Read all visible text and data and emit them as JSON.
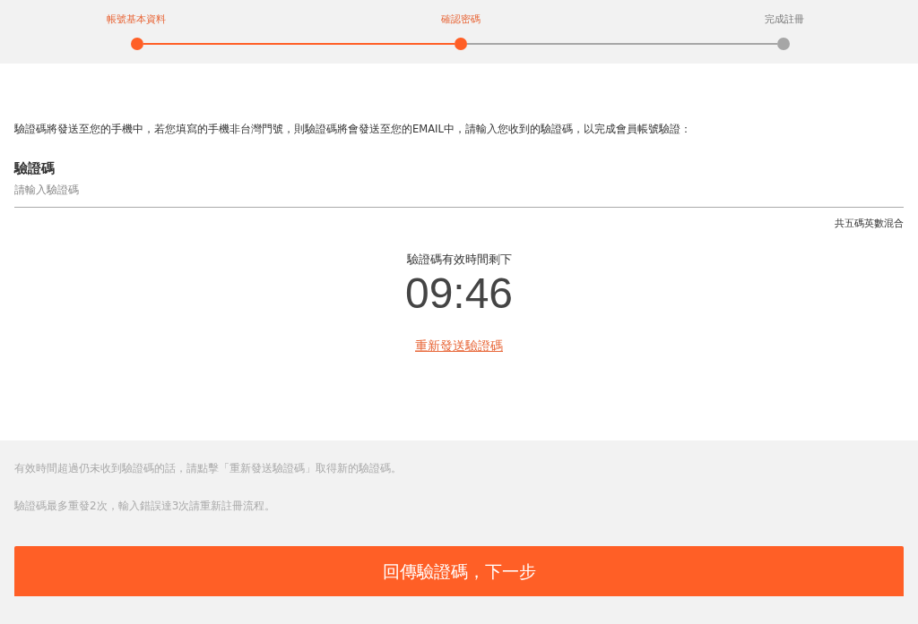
{
  "steps": [
    {
      "label": "帳號基本資料",
      "reached": true
    },
    {
      "label": "確認密碼",
      "reached": true
    },
    {
      "label": "完成註冊",
      "reached": false
    }
  ],
  "intro": "驗證碼將發送至您的手機中，若您填寫的手機非台灣門號，則驗證碼將會發送至您的EMAIL中，請輸入您收到的驗證碼，以完成會員帳號驗證：",
  "field": {
    "label": "驗證碼",
    "placeholder": "請輸入驗證碼",
    "hint": "共五碼英數混合"
  },
  "timer": {
    "caption": "驗證碼有效時間剩下",
    "time": "09:46"
  },
  "resend_link": "重新發送驗證碼",
  "notes": [
    "有效時間超過仍未收到驗證碼的話，請點擊「重新發送驗證碼」取得新的驗證碼。",
    "驗證碼最多重發2次，輸入錯誤達3次請重新註冊流程。"
  ],
  "submit_button": "回傳驗證碼，下一步"
}
